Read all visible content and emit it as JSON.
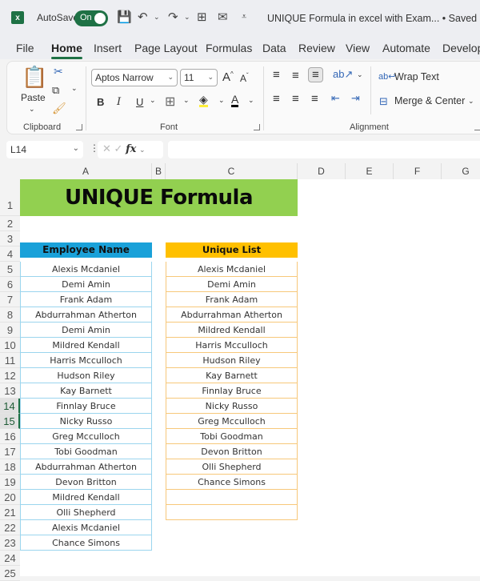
{
  "titlebar": {
    "autosave_label": "AutoSave",
    "autosave_state": "On",
    "doc_title": "UNIQUE Formula in excel with Exam... • Saved ⌄"
  },
  "menu": [
    "File",
    "Home",
    "Insert",
    "Page Layout",
    "Formulas",
    "Data",
    "Review",
    "View",
    "Automate",
    "Develop"
  ],
  "active_menu": "Home",
  "ribbon": {
    "paste_label": "Paste",
    "clipboard_label": "Clipboard",
    "font_name": "Aptos Narrow",
    "font_size": "11",
    "font_label": "Font",
    "alignment_label": "Alignment",
    "wrap_text_label": "Wrap Text",
    "merge_center_label": "Merge & Center",
    "bold": "B",
    "italic": "I",
    "underline": "U"
  },
  "formula_bar": {
    "name_box": "L14",
    "fx": "fx",
    "formula": ""
  },
  "columns": [
    "A",
    "B",
    "C",
    "D",
    "E",
    "F",
    "G"
  ],
  "rows": [
    "1",
    "2",
    "3",
    "4",
    "5",
    "6",
    "7",
    "8",
    "9",
    "10",
    "11",
    "12",
    "13",
    "14",
    "15",
    "16",
    "17",
    "18",
    "19",
    "20",
    "21",
    "22",
    "23",
    "24",
    "25"
  ],
  "selected_rows": [
    "14",
    "15"
  ],
  "sheet": {
    "title": "UNIQUE Formula",
    "employee_header": "Employee Name",
    "unique_header": "Unique List",
    "employees": [
      "Alexis Mcdaniel",
      "Demi Amin",
      "Frank Adam",
      "Abdurrahman Atherton",
      "Demi Amin",
      "Mildred Kendall",
      "Harris Mcculloch",
      "Hudson Riley",
      "Kay Barnett",
      "Finnlay Bruce",
      "Nicky Russo",
      "Greg Mcculloch",
      "Tobi Goodman",
      "Abdurrahman Atherton",
      "Devon Britton",
      "Mildred Kendall",
      "Olli Shepherd",
      "Alexis Mcdaniel",
      "Chance Simons"
    ],
    "unique": [
      "Alexis Mcdaniel",
      "Demi Amin",
      "Frank Adam",
      "Abdurrahman Atherton",
      "Mildred Kendall",
      "Harris Mcculloch",
      "Hudson Riley",
      "Kay Barnett",
      "Finnlay Bruce",
      "Nicky Russo",
      "Greg Mcculloch",
      "Tobi Goodman",
      "Devon Britton",
      "Olli Shepherd",
      "Chance Simons",
      "",
      ""
    ]
  },
  "colors": {
    "title_fill": "#92d050",
    "employee_header_fill": "#1aa1d9",
    "unique_header_fill": "#ffc000",
    "accent": "#1e7145"
  }
}
